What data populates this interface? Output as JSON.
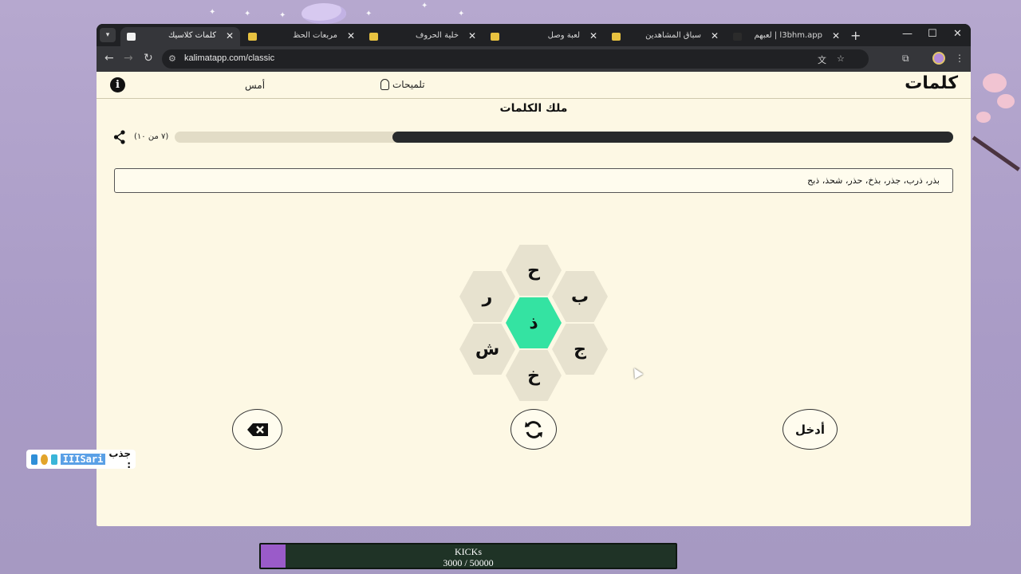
{
  "browser": {
    "tabs": [
      {
        "label": "كلمات كلاسيك",
        "active": true
      },
      {
        "label": "مربعات الحظ",
        "active": false
      },
      {
        "label": "خلية الحروف",
        "active": false
      },
      {
        "label": "لعبة وصل",
        "active": false
      },
      {
        "label": "سباق المشاهدين",
        "active": false
      },
      {
        "label": "l3bhm.app | لعبهم",
        "active": false
      }
    ],
    "url": "kalimatapp.com/classic"
  },
  "header": {
    "logo": "كلمات",
    "hints_label": "تلميحات",
    "yesterday_label": "أمس",
    "info_symbol": "i"
  },
  "game": {
    "rank_title": "ملك الكلمات",
    "progress_count": "(٧ من ١٠)",
    "progress_fraction": 0.72,
    "found_words": "بذر، ذرب، جذر، بذخ، حذر، شحذ، ذبح",
    "letters": {
      "top": "ح",
      "upper_right": "ب",
      "upper_left": "ر",
      "center": "ذ",
      "lower_right": "ج",
      "lower_left": "ش",
      "bottom": "خ"
    },
    "enter_label": "أدخل",
    "shuffle_icon": "refresh-icon",
    "delete_icon": "backspace-icon"
  },
  "overlay": {
    "badge_label": "جذب :",
    "badge_name": "IIISari",
    "kicks_title": "KICKs",
    "kicks_value": "3000 / 50000",
    "kicks_fraction": 0.06
  },
  "colors": {
    "page_bg": "#fdf8e4",
    "center_hex": "#34e3a2",
    "hex": "#e7e2cf",
    "progress": "#272a2c"
  }
}
